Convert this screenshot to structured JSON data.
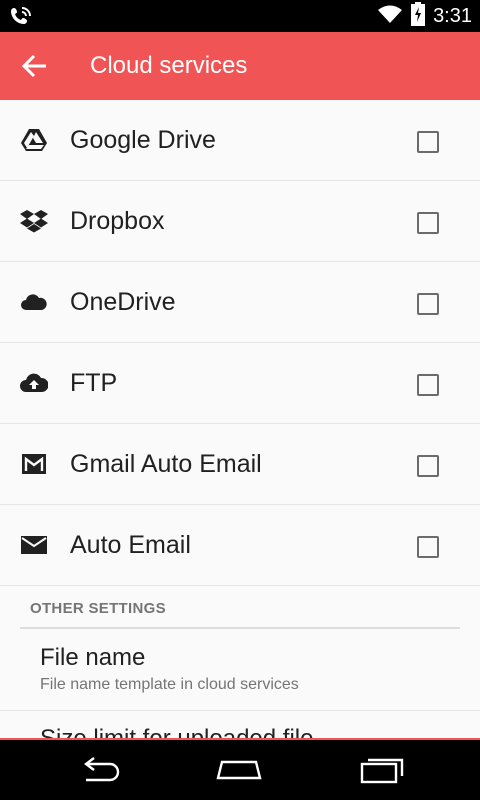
{
  "status_bar": {
    "time": "3:31",
    "icons": [
      "phone-wifi-icon",
      "wifi-icon",
      "battery-charging-icon"
    ]
  },
  "app_bar": {
    "title": "Cloud services",
    "back_icon": "arrow-back-icon"
  },
  "services": [
    {
      "label": "Google Drive",
      "icon": "google-drive-icon",
      "checked": false
    },
    {
      "label": "Dropbox",
      "icon": "dropbox-icon",
      "checked": false
    },
    {
      "label": "OneDrive",
      "icon": "cloud-icon",
      "checked": false
    },
    {
      "label": "FTP",
      "icon": "cloud-upload-icon",
      "checked": false
    },
    {
      "label": "Gmail Auto Email",
      "icon": "gmail-icon",
      "checked": false
    },
    {
      "label": "Auto Email",
      "icon": "email-icon",
      "checked": false
    }
  ],
  "other_settings": {
    "section_title": "OTHER SETTINGS",
    "file_name": {
      "title": "File name",
      "summary": "File name template in cloud services"
    },
    "size_limit": {
      "title": "Size limit for uploaded file"
    }
  },
  "nav_bar": {
    "icons": [
      "back-nav-icon",
      "home-nav-icon",
      "recents-nav-icon"
    ]
  },
  "colors": {
    "accent": "#f05454",
    "text_primary": "#212121",
    "text_secondary": "#757575"
  }
}
